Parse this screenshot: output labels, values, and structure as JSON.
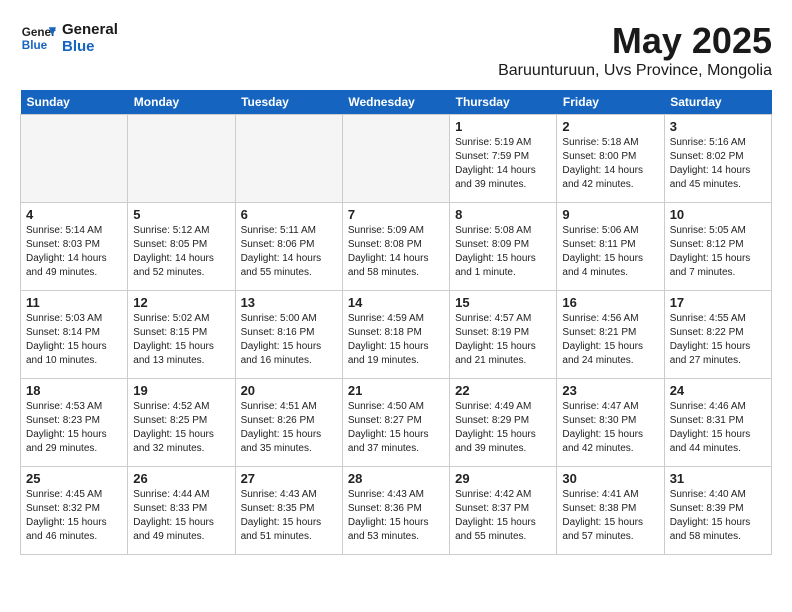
{
  "logo": {
    "general": "General",
    "blue": "Blue"
  },
  "header": {
    "month": "May 2025",
    "location": "Baruunturuun, Uvs Province, Mongolia"
  },
  "weekdays": [
    "Sunday",
    "Monday",
    "Tuesday",
    "Wednesday",
    "Thursday",
    "Friday",
    "Saturday"
  ],
  "weeks": [
    [
      {
        "day": "",
        "info": ""
      },
      {
        "day": "",
        "info": ""
      },
      {
        "day": "",
        "info": ""
      },
      {
        "day": "",
        "info": ""
      },
      {
        "day": "1",
        "info": "Sunrise: 5:19 AM\nSunset: 7:59 PM\nDaylight: 14 hours\nand 39 minutes."
      },
      {
        "day": "2",
        "info": "Sunrise: 5:18 AM\nSunset: 8:00 PM\nDaylight: 14 hours\nand 42 minutes."
      },
      {
        "day": "3",
        "info": "Sunrise: 5:16 AM\nSunset: 8:02 PM\nDaylight: 14 hours\nand 45 minutes."
      }
    ],
    [
      {
        "day": "4",
        "info": "Sunrise: 5:14 AM\nSunset: 8:03 PM\nDaylight: 14 hours\nand 49 minutes."
      },
      {
        "day": "5",
        "info": "Sunrise: 5:12 AM\nSunset: 8:05 PM\nDaylight: 14 hours\nand 52 minutes."
      },
      {
        "day": "6",
        "info": "Sunrise: 5:11 AM\nSunset: 8:06 PM\nDaylight: 14 hours\nand 55 minutes."
      },
      {
        "day": "7",
        "info": "Sunrise: 5:09 AM\nSunset: 8:08 PM\nDaylight: 14 hours\nand 58 minutes."
      },
      {
        "day": "8",
        "info": "Sunrise: 5:08 AM\nSunset: 8:09 PM\nDaylight: 15 hours\nand 1 minute."
      },
      {
        "day": "9",
        "info": "Sunrise: 5:06 AM\nSunset: 8:11 PM\nDaylight: 15 hours\nand 4 minutes."
      },
      {
        "day": "10",
        "info": "Sunrise: 5:05 AM\nSunset: 8:12 PM\nDaylight: 15 hours\nand 7 minutes."
      }
    ],
    [
      {
        "day": "11",
        "info": "Sunrise: 5:03 AM\nSunset: 8:14 PM\nDaylight: 15 hours\nand 10 minutes."
      },
      {
        "day": "12",
        "info": "Sunrise: 5:02 AM\nSunset: 8:15 PM\nDaylight: 15 hours\nand 13 minutes."
      },
      {
        "day": "13",
        "info": "Sunrise: 5:00 AM\nSunset: 8:16 PM\nDaylight: 15 hours\nand 16 minutes."
      },
      {
        "day": "14",
        "info": "Sunrise: 4:59 AM\nSunset: 8:18 PM\nDaylight: 15 hours\nand 19 minutes."
      },
      {
        "day": "15",
        "info": "Sunrise: 4:57 AM\nSunset: 8:19 PM\nDaylight: 15 hours\nand 21 minutes."
      },
      {
        "day": "16",
        "info": "Sunrise: 4:56 AM\nSunset: 8:21 PM\nDaylight: 15 hours\nand 24 minutes."
      },
      {
        "day": "17",
        "info": "Sunrise: 4:55 AM\nSunset: 8:22 PM\nDaylight: 15 hours\nand 27 minutes."
      }
    ],
    [
      {
        "day": "18",
        "info": "Sunrise: 4:53 AM\nSunset: 8:23 PM\nDaylight: 15 hours\nand 29 minutes."
      },
      {
        "day": "19",
        "info": "Sunrise: 4:52 AM\nSunset: 8:25 PM\nDaylight: 15 hours\nand 32 minutes."
      },
      {
        "day": "20",
        "info": "Sunrise: 4:51 AM\nSunset: 8:26 PM\nDaylight: 15 hours\nand 35 minutes."
      },
      {
        "day": "21",
        "info": "Sunrise: 4:50 AM\nSunset: 8:27 PM\nDaylight: 15 hours\nand 37 minutes."
      },
      {
        "day": "22",
        "info": "Sunrise: 4:49 AM\nSunset: 8:29 PM\nDaylight: 15 hours\nand 39 minutes."
      },
      {
        "day": "23",
        "info": "Sunrise: 4:47 AM\nSunset: 8:30 PM\nDaylight: 15 hours\nand 42 minutes."
      },
      {
        "day": "24",
        "info": "Sunrise: 4:46 AM\nSunset: 8:31 PM\nDaylight: 15 hours\nand 44 minutes."
      }
    ],
    [
      {
        "day": "25",
        "info": "Sunrise: 4:45 AM\nSunset: 8:32 PM\nDaylight: 15 hours\nand 46 minutes."
      },
      {
        "day": "26",
        "info": "Sunrise: 4:44 AM\nSunset: 8:33 PM\nDaylight: 15 hours\nand 49 minutes."
      },
      {
        "day": "27",
        "info": "Sunrise: 4:43 AM\nSunset: 8:35 PM\nDaylight: 15 hours\nand 51 minutes."
      },
      {
        "day": "28",
        "info": "Sunrise: 4:43 AM\nSunset: 8:36 PM\nDaylight: 15 hours\nand 53 minutes."
      },
      {
        "day": "29",
        "info": "Sunrise: 4:42 AM\nSunset: 8:37 PM\nDaylight: 15 hours\nand 55 minutes."
      },
      {
        "day": "30",
        "info": "Sunrise: 4:41 AM\nSunset: 8:38 PM\nDaylight: 15 hours\nand 57 minutes."
      },
      {
        "day": "31",
        "info": "Sunrise: 4:40 AM\nSunset: 8:39 PM\nDaylight: 15 hours\nand 58 minutes."
      }
    ]
  ]
}
